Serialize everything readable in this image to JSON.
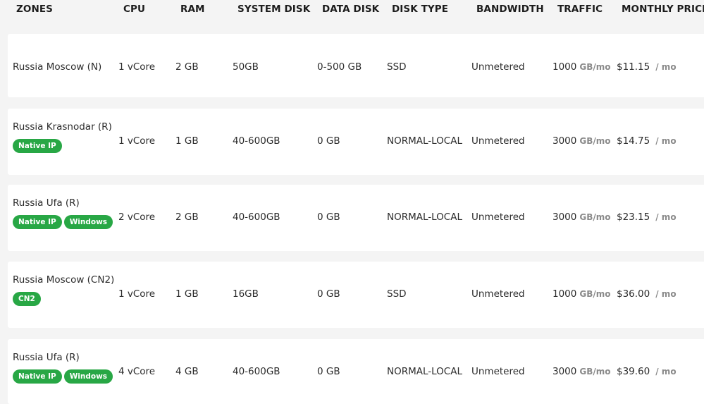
{
  "headers": {
    "zones": "ZONES",
    "cpu": "CPU",
    "ram": "RAM",
    "system_disk": "SYSTEM DISK",
    "data_disk": "DATA DISK",
    "disk_type": "DISK TYPE",
    "bandwidth": "BANDWIDTH",
    "traffic": "TRAFFIC",
    "monthly_price": "MONTHLY PRICE"
  },
  "rows": [
    {
      "zone": "Russia Moscow (N)",
      "badges": [],
      "cpu": "1 vCore",
      "ram": "2 GB",
      "system_disk": "50GB",
      "data_disk": "0-500 GB",
      "disk_type": "SSD",
      "bandwidth": "Unmetered",
      "traffic": "1000",
      "traffic_unit": "GB/mo",
      "price": "$11.15",
      "price_period": "/ mo"
    },
    {
      "zone": "Russia Krasnodar (R)",
      "badges": [
        "Native IP"
      ],
      "cpu": "1 vCore",
      "ram": "1 GB",
      "system_disk": "40-600GB",
      "data_disk": "0 GB",
      "disk_type": "NORMAL-LOCAL",
      "bandwidth": "Unmetered",
      "traffic": "3000",
      "traffic_unit": "GB/mo",
      "price": "$14.75",
      "price_period": "/ mo"
    },
    {
      "zone": "Russia Ufa (R)",
      "badges": [
        "Native IP",
        "Windows"
      ],
      "cpu": "2 vCore",
      "ram": "2 GB",
      "system_disk": "40-600GB",
      "data_disk": "0 GB",
      "disk_type": "NORMAL-LOCAL",
      "bandwidth": "Unmetered",
      "traffic": "3000",
      "traffic_unit": "GB/mo",
      "price": "$23.15",
      "price_period": "/ mo"
    },
    {
      "zone": "Russia Moscow (CN2)",
      "badges": [
        "CN2"
      ],
      "cpu": "1 vCore",
      "ram": "1 GB",
      "system_disk": "16GB",
      "data_disk": "0 GB",
      "disk_type": "SSD",
      "bandwidth": "Unmetered",
      "traffic": "1000",
      "traffic_unit": "GB/mo",
      "price": "$36.00",
      "price_period": "/ mo"
    },
    {
      "zone": "Russia Ufa (R)",
      "badges": [
        "Native IP",
        "Windows"
      ],
      "cpu": "4 vCore",
      "ram": "4 GB",
      "system_disk": "40-600GB",
      "data_disk": "0 GB",
      "disk_type": "NORMAL-LOCAL",
      "bandwidth": "Unmetered",
      "traffic": "3000",
      "traffic_unit": "GB/mo",
      "price": "$39.60",
      "price_period": "/ mo"
    }
  ],
  "colors": {
    "badge_green": "#28a745",
    "page_background": "#f4f4f4",
    "row_background": "#ffffff"
  }
}
